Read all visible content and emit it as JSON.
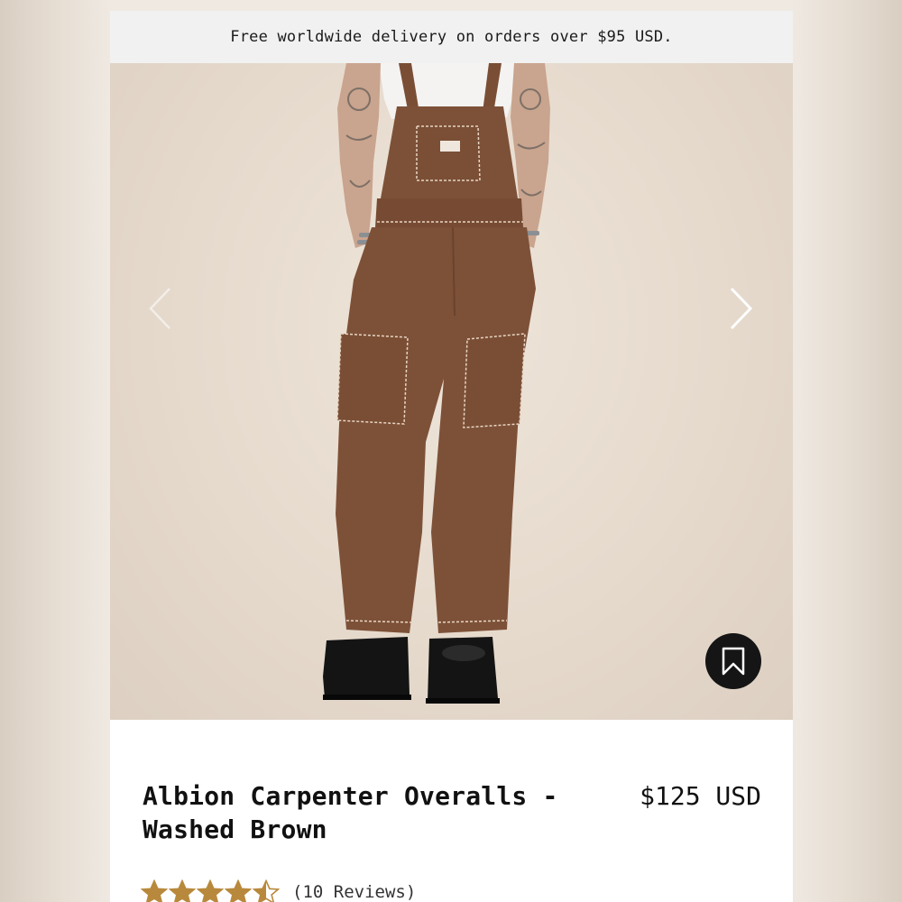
{
  "promo": {
    "text": "Free worldwide delivery on orders over $95 USD."
  },
  "gallery": {
    "prev_icon": "chevron-left-icon",
    "next_icon": "chevron-right-icon",
    "save_icon": "bookmark-icon"
  },
  "product": {
    "title": "Albion Carpenter Overalls - Washed Brown",
    "price": "$125 USD",
    "rating": 4.5,
    "rating_max": 5,
    "reviews_label": "(10 Reviews)"
  },
  "colors": {
    "star": "#b8893c",
    "overall_brown": "#7d5138",
    "background": "#e6dacd"
  }
}
